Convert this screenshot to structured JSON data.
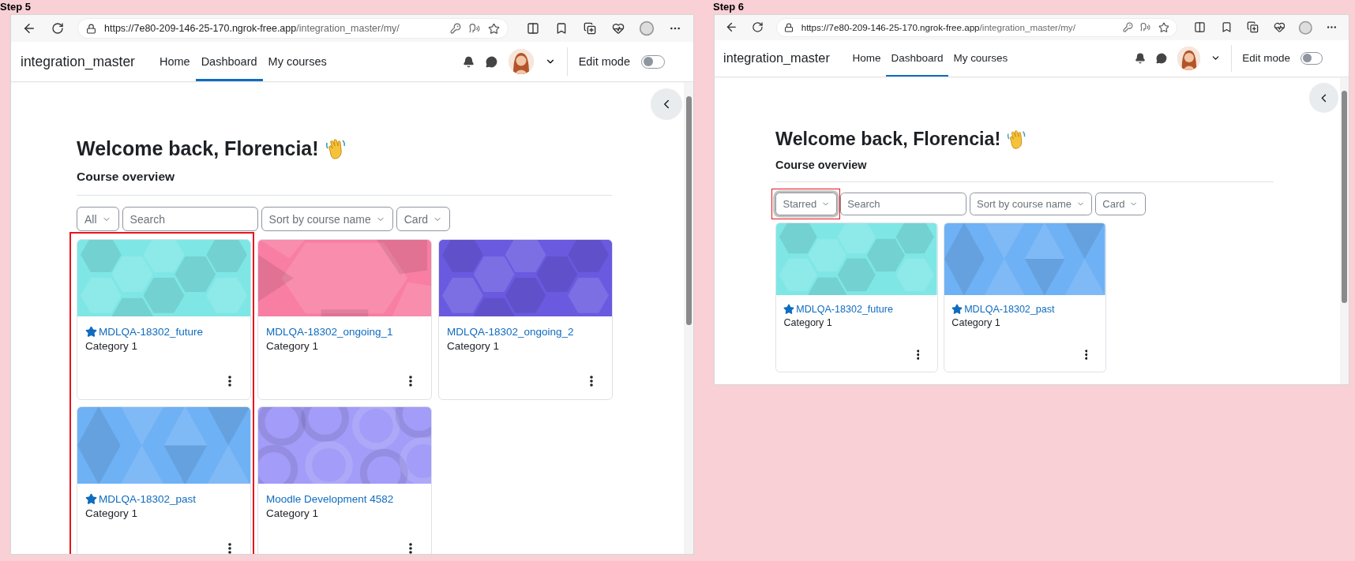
{
  "steps": [
    {
      "label": "Step 5",
      "browser": {
        "url_origin": "https://7e80-209-146-25-170.ngrok-free.app",
        "url_path": "/integration_master/my/"
      },
      "site": {
        "brand": "integration_master",
        "nav": [
          {
            "label": "Home",
            "selected": false
          },
          {
            "label": "Dashboard",
            "selected": true
          },
          {
            "label": "My courses",
            "selected": false
          }
        ],
        "edit_mode": {
          "label": "Edit mode",
          "on": false
        }
      },
      "heading": "Welcome back, Florencia!",
      "section": "Course overview",
      "filters": [
        {
          "kind": "dropdown",
          "label": "All",
          "focused": false,
          "highlighted": false
        },
        {
          "kind": "search",
          "placeholder": "Search",
          "highlighted": false
        },
        {
          "kind": "dropdown",
          "label": "Sort by course name",
          "focused": false,
          "highlighted": false
        },
        {
          "kind": "dropdown",
          "label": "Card",
          "focused": false,
          "highlighted": false
        }
      ],
      "courses": [
        {
          "name": "MDLQA-18302_future",
          "category": "Category 1",
          "starred": true,
          "highlighted": true,
          "color": "#7fe6e6"
        },
        {
          "name": "MDLQA-18302_ongoing_1",
          "category": "Category 1",
          "starred": false,
          "highlighted": false,
          "color": "#f87ea3"
        },
        {
          "name": "MDLQA-18302_ongoing_2",
          "category": "Category 1",
          "starred": false,
          "highlighted": false,
          "color": "#6a5ae0"
        },
        {
          "name": "MDLQA-18302_past",
          "category": "Category 1",
          "starred": true,
          "highlighted": true,
          "color": "#6fb1f5"
        },
        {
          "name": "Moodle Development 4582",
          "category": "Category 1",
          "starred": false,
          "highlighted": false,
          "color": "#a39cf8"
        }
      ]
    },
    {
      "label": "Step 6",
      "browser": {
        "url_origin": "https://7e80-209-146-25-170.ngrok-free.app",
        "url_path": "/integration_master/my/"
      },
      "site": {
        "brand": "integration_master",
        "nav": [
          {
            "label": "Home",
            "selected": false
          },
          {
            "label": "Dashboard",
            "selected": true
          },
          {
            "label": "My courses",
            "selected": false
          }
        ],
        "edit_mode": {
          "label": "Edit mode",
          "on": false
        }
      },
      "heading": "Welcome back, Florencia!",
      "section": "Course overview",
      "filters": [
        {
          "kind": "dropdown",
          "label": "Starred",
          "focused": true,
          "highlighted": true
        },
        {
          "kind": "search",
          "placeholder": "Search",
          "highlighted": false
        },
        {
          "kind": "dropdown",
          "label": "Sort by course name",
          "focused": false,
          "highlighted": false
        },
        {
          "kind": "dropdown",
          "label": "Card",
          "focused": false,
          "highlighted": false
        }
      ],
      "courses": [
        {
          "name": "MDLQA-18302_future",
          "category": "Category 1",
          "starred": true,
          "highlighted": false,
          "color": "#7fe6e6"
        },
        {
          "name": "MDLQA-18302_past",
          "category": "Category 1",
          "starred": true,
          "highlighted": false,
          "color": "#6fb1f5"
        }
      ]
    }
  ]
}
